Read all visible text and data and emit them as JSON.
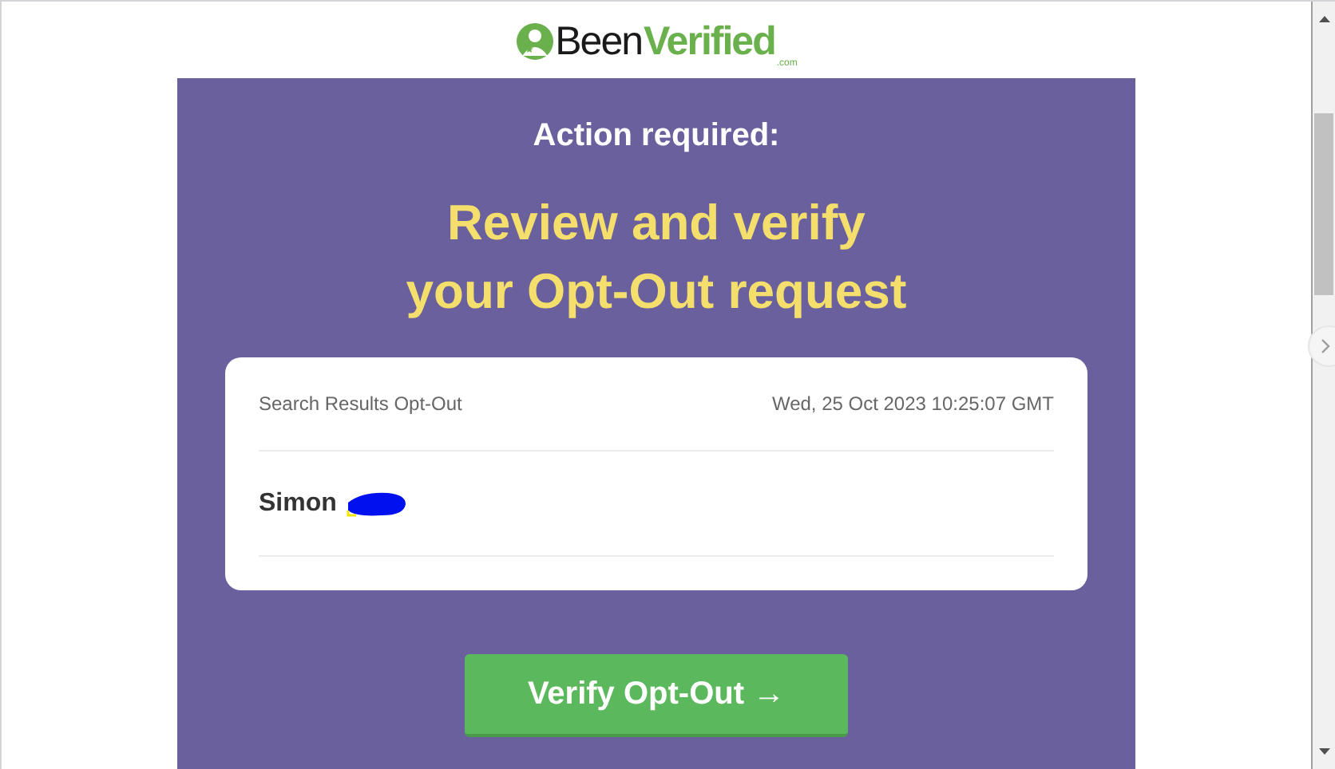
{
  "logo": {
    "word_1": "Been",
    "word_2": "Verified",
    "suffix": ".com"
  },
  "banner": {
    "eyebrow": "Action required:",
    "headline_1": "Review and verify",
    "headline_2": "your Opt-Out request"
  },
  "card": {
    "label": "Search Results Opt-Out",
    "timestamp": "Wed, 25 Oct 2023 10:25:07 GMT",
    "name": "Simon",
    "name_redacted": true
  },
  "button": {
    "label": "Verify Opt-Out →"
  }
}
